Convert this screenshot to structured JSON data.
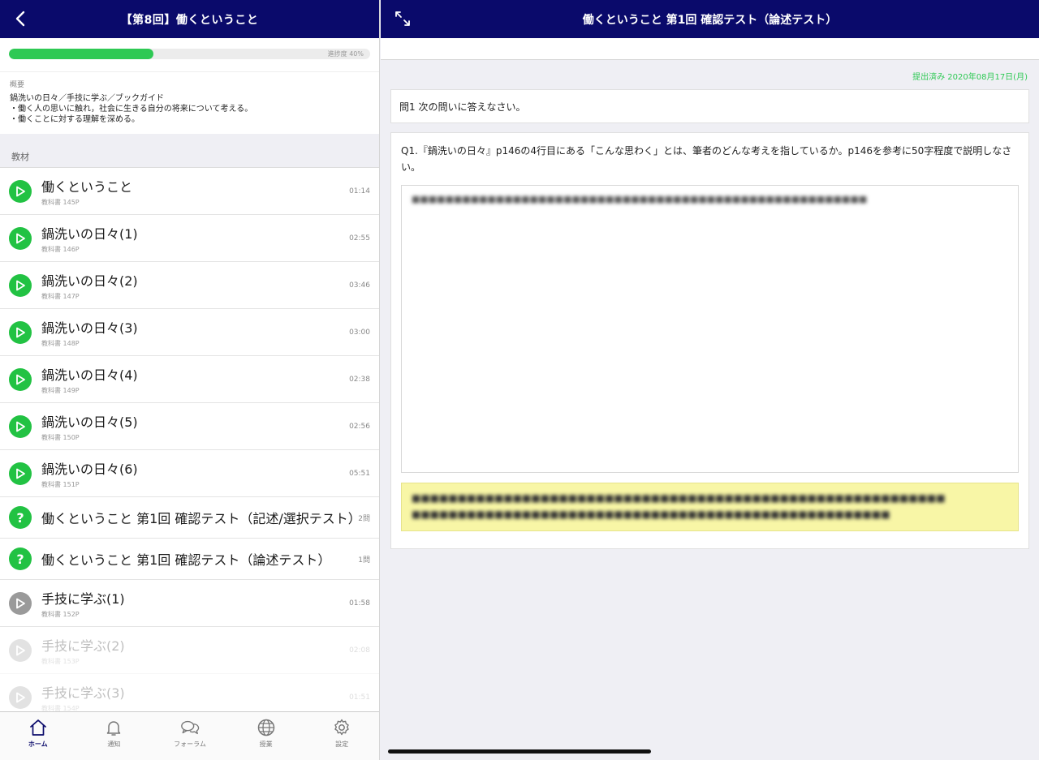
{
  "left": {
    "header_title": "【第8回】働くということ",
    "progress_label": "進捗度 40%",
    "progress_value": 0.4,
    "summary_label": "概要",
    "summary_lines": [
      "鍋洗いの日々／手技に学ぶ／ブックガイド",
      "・働く人の思いに触れ，社会に生きる自分の将来について考える。",
      "・働くことに対する理解を深める。"
    ],
    "section_label": "教材",
    "items": [
      {
        "name": "働くということ",
        "sub": "教科書 145P",
        "meta": "01:14"
      },
      {
        "name": "鍋洗いの日々(1)",
        "sub": "教科書 146P",
        "meta": "02:55"
      },
      {
        "name": "鍋洗いの日々(2)",
        "sub": "教科書 147P",
        "meta": "03:46"
      },
      {
        "name": "鍋洗いの日々(3)",
        "sub": "教科書 148P",
        "meta": "03:00"
      },
      {
        "name": "鍋洗いの日々(4)",
        "sub": "教科書 149P",
        "meta": "02:38"
      },
      {
        "name": "鍋洗いの日々(5)",
        "sub": "教科書 150P",
        "meta": "02:56"
      },
      {
        "name": "鍋洗いの日々(6)",
        "sub": "教科書 151P",
        "meta": "05:51"
      },
      {
        "name": "働くということ 第1回 確認テスト（記述/選択テスト）",
        "meta": "2問"
      },
      {
        "name": "働くということ 第1回 確認テスト（論述テスト）",
        "meta": "1問"
      },
      {
        "name": "手技に学ぶ(1)",
        "sub": "教科書 152P",
        "meta": "01:58"
      },
      {
        "name": "手技に学ぶ(2)",
        "sub": "教科書 153P",
        "meta": "02:08"
      },
      {
        "name": "手技に学ぶ(3)",
        "sub": "教科書 154P",
        "meta": "01:51"
      }
    ]
  },
  "tabs": [
    {
      "label": "ホーム",
      "icon": "home-icon"
    },
    {
      "label": "通知",
      "icon": "bell-icon"
    },
    {
      "label": "フォーラム",
      "icon": "chat-icon"
    },
    {
      "label": "授業",
      "icon": "globe-icon"
    },
    {
      "label": "設定",
      "icon": "gear-icon"
    }
  ],
  "right": {
    "header_title": "働くということ 第1回 確認テスト（論述テスト）",
    "submitted": "提出済み 2020年08月17日(月)",
    "instruction": "問1 次の問いに答えなさい。",
    "question": "Q1.『鍋洗いの日々』p146の4行目にある「こんな思わく」とは、筆者のどんな考えを指しているか。p146を参考に50字程度で説明しなさい。"
  },
  "colors": {
    "header_bg": "#0a0a6b",
    "accent_green": "#2ec954",
    "icon_green": "#22c243",
    "highlight_yellow": "#f8f6a6"
  }
}
